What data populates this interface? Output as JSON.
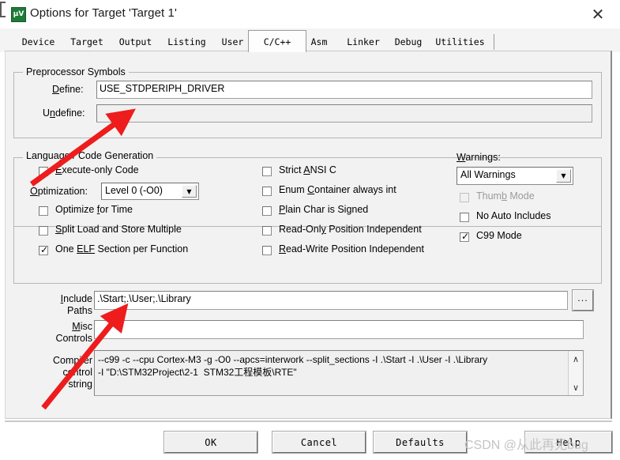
{
  "window": {
    "title": "Options for Target 'Target 1'",
    "icon": "uvision-icon",
    "icon_glyph": "µV",
    "close_label": "✕"
  },
  "tabs": [
    {
      "label": "Device",
      "active": false
    },
    {
      "label": "Target",
      "active": false
    },
    {
      "label": "Output",
      "active": false
    },
    {
      "label": "Listing",
      "active": false
    },
    {
      "label": "User",
      "active": false
    },
    {
      "label": "C/C++",
      "active": true
    },
    {
      "label": "Asm",
      "active": false
    },
    {
      "label": "Linker",
      "active": false
    },
    {
      "label": "Debug",
      "active": false
    },
    {
      "label": "Utilities",
      "active": false
    }
  ],
  "preprocessor": {
    "group_title": "Preprocessor Symbols",
    "define_label": "Define:",
    "define_value": "USE_STDPERIPH_DRIVER",
    "undefine_label": "Undefine:",
    "undefine_value": ""
  },
  "language": {
    "group_title": "Language / Code Generation",
    "col1": [
      {
        "label": "Execute-only Code",
        "checked": false,
        "enabled": true
      },
      {
        "label": "Optimize for Time",
        "checked": false,
        "enabled": true
      },
      {
        "label": "Split Load and Store Multiple",
        "checked": false,
        "enabled": true
      },
      {
        "label": "One ELF Section per Function",
        "checked": true,
        "enabled": true
      }
    ],
    "optimization_label": "Optimization:",
    "optimization_value": "Level 0 (-O0)",
    "col2": [
      {
        "label": "Strict ANSI C",
        "checked": false,
        "enabled": true
      },
      {
        "label": "Enum Container always int",
        "checked": false,
        "enabled": true
      },
      {
        "label": "Plain Char is Signed",
        "checked": false,
        "enabled": true
      },
      {
        "label": "Read-Only Position Independent",
        "checked": false,
        "enabled": true
      },
      {
        "label": "Read-Write Position Independent",
        "checked": false,
        "enabled": true
      }
    ],
    "warnings_label": "Warnings:",
    "warnings_value": "All Warnings",
    "col3": [
      {
        "label": "Thumb Mode",
        "checked": false,
        "enabled": false
      },
      {
        "label": "No Auto Includes",
        "checked": false,
        "enabled": true
      },
      {
        "label": "C99 Mode",
        "checked": true,
        "enabled": true
      }
    ]
  },
  "paths": {
    "include_label_line1": "Include",
    "include_label_line2": "Paths",
    "include_value": ".\\Start;.\\User;.\\Library",
    "browse_label": "...",
    "misc_label_line1": "Misc",
    "misc_label_line2": "Controls",
    "misc_value": "",
    "compiler_label_line1": "Compiler",
    "compiler_label_line2": "control",
    "compiler_label_line3": "string",
    "compiler_value": "--c99 -c --cpu Cortex-M3 -g -O0 --apcs=interwork --split_sections -I .\\Start -I .\\User -I .\\Library\n-I \"D:\\STM32Project\\2-1  STM32工程模板\\RTE\"",
    "scroll_up": "∧",
    "scroll_down": "∨"
  },
  "buttons": {
    "ok": "OK",
    "cancel": "Cancel",
    "defaults": "Defaults",
    "help": "Help"
  },
  "watermark": "CSDN @从此再无bug",
  "annotations": {
    "arrow_color": "#ee1c1c",
    "arrow1": "points to Define field",
    "arrow2": "points to Include Paths field"
  }
}
